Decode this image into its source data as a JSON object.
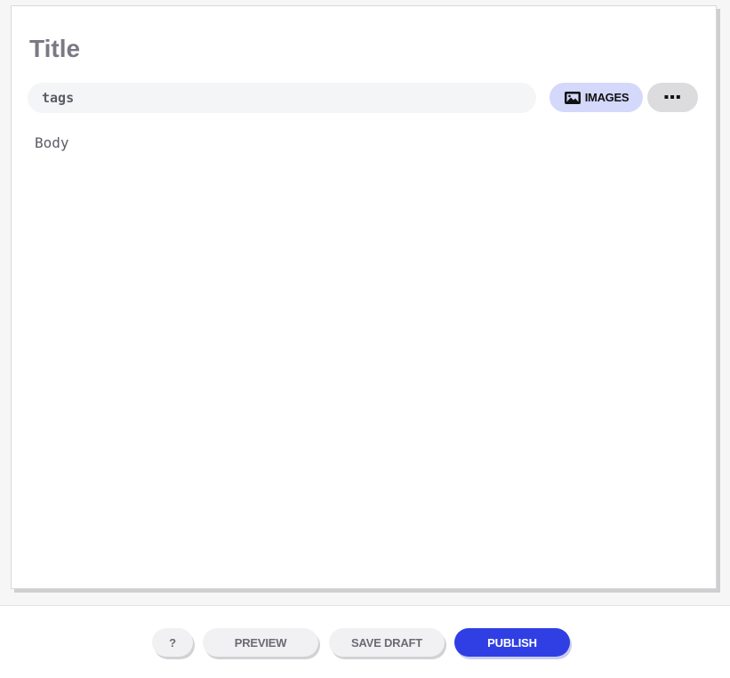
{
  "editor": {
    "title_placeholder": "Title",
    "tags_placeholder": "tags",
    "body_placeholder": "Body",
    "images_label": "IMAGES",
    "images_icon": "image-icon",
    "more_label": "▪▪▪"
  },
  "footer": {
    "help_label": "?",
    "preview_label": "PREVIEW",
    "save_draft_label": "SAVE DRAFT",
    "publish_label": "PUBLISH"
  },
  "colors": {
    "publish_bg": "#2f3fe3",
    "images_bg": "#d4d8fb",
    "more_bg": "#dcdcdf"
  }
}
